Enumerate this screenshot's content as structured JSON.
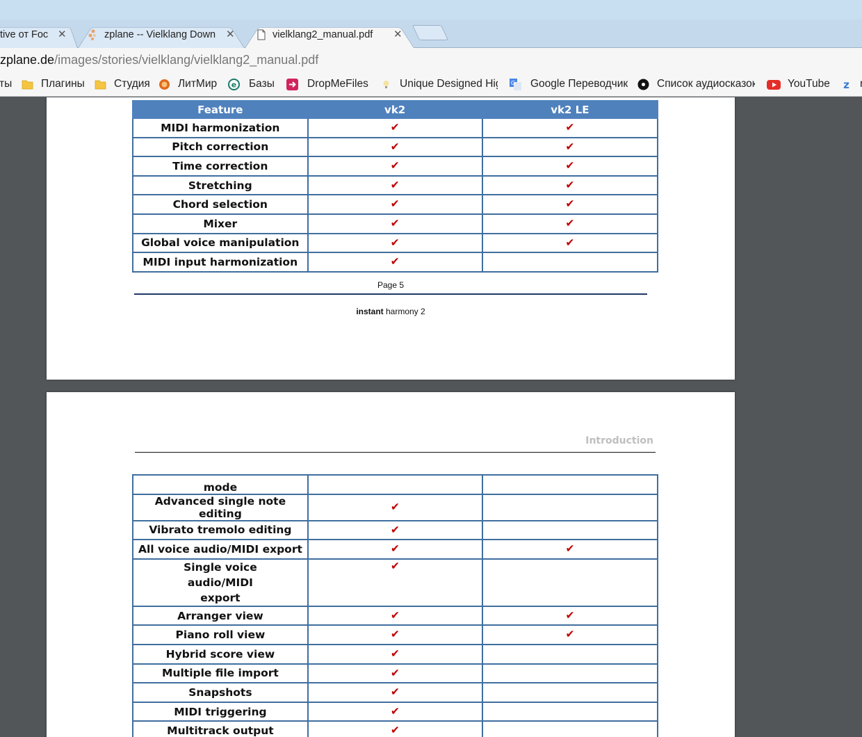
{
  "browser": {
    "tabs": [
      {
        "title": "tive от Foc",
        "close": "✕",
        "icon": "generic-icon"
      },
      {
        "title": "zplane -- Vielklang Down",
        "close": "✕",
        "icon": "zplane-favicon-icon"
      },
      {
        "title": "vielklang2_manual.pdf",
        "close": "✕",
        "icon": "document-icon"
      }
    ],
    "url": {
      "host": "zplane.de",
      "path": "/images/stories/vielklang/vielklang2_manual.pdf"
    },
    "bookmarks": [
      {
        "label": "ты",
        "icon": ""
      },
      {
        "label": "Плагины",
        "icon": "folder-icon"
      },
      {
        "label": "Студия",
        "icon": "folder-icon"
      },
      {
        "label": "ЛитМир",
        "icon": "litmir-icon"
      },
      {
        "label": "Базы",
        "icon": "e-icon"
      },
      {
        "label": "DropMeFiles",
        "icon": "dropmefiles-icon"
      },
      {
        "label": "Unique Designed Hig",
        "icon": "bulb-icon"
      },
      {
        "label": "Google Переводчик",
        "icon": "google-translate-icon"
      },
      {
        "label": "Список аудиосказок",
        "icon": "vinyl-icon"
      },
      {
        "label": "YouTube",
        "icon": "youtube-icon"
      },
      {
        "label": "r",
        "icon": "z-icon"
      }
    ]
  },
  "colors": {
    "table_header": "#4f81bd",
    "table_border": "#3f6e9f",
    "check": "#c00000"
  },
  "pdf": {
    "page1": {
      "table": {
        "headers": [
          "Feature",
          "vk2",
          "vk2 LE"
        ],
        "rows": [
          {
            "feature": "MIDI harmonization",
            "vk2": "✔",
            "vk2le": "✔"
          },
          {
            "feature": "Pitch correction",
            "vk2": "✔",
            "vk2le": "✔"
          },
          {
            "feature": "Time correction",
            "vk2": "✔",
            "vk2le": "✔"
          },
          {
            "feature": "Stretching",
            "vk2": "✔",
            "vk2le": "✔"
          },
          {
            "feature": "Chord selection",
            "vk2": "✔",
            "vk2le": "✔"
          },
          {
            "feature": "Mixer",
            "vk2": "✔",
            "vk2le": "✔"
          },
          {
            "feature": "Global voice manipulation",
            "vk2": "✔",
            "vk2le": "✔"
          },
          {
            "feature": "MIDI input harmonization",
            "vk2": "✔",
            "vk2le": ""
          }
        ]
      },
      "page_number": "Page 5",
      "footer_bold": "instant",
      "footer_rest": " harmony 2"
    },
    "page2": {
      "header": "Introduction",
      "table": {
        "rows": [
          {
            "feature": "mode",
            "vk2": "",
            "vk2le": ""
          },
          {
            "feature": "Advanced single note editing",
            "vk2": "✔",
            "vk2le": ""
          },
          {
            "feature": "Vibrato tremolo editing",
            "vk2": "✔",
            "vk2le": ""
          },
          {
            "feature": "All voice audio/MIDI export",
            "vk2": "✔",
            "vk2le": "✔"
          },
          {
            "feature": "Single voice audio/MIDI export",
            "vk2": "✔",
            "vk2le": ""
          },
          {
            "feature": "Arranger view",
            "vk2": "✔",
            "vk2le": "✔"
          },
          {
            "feature": "Piano roll view",
            "vk2": "✔",
            "vk2le": "✔"
          },
          {
            "feature": "Hybrid score view",
            "vk2": "✔",
            "vk2le": ""
          },
          {
            "feature": "Multiple file import",
            "vk2": "✔",
            "vk2le": ""
          },
          {
            "feature": "Snapshots",
            "vk2": "✔",
            "vk2le": ""
          },
          {
            "feature": "MIDI triggering",
            "vk2": "✔",
            "vk2le": ""
          },
          {
            "feature": "Multitrack output",
            "vk2": "✔",
            "vk2le": ""
          }
        ]
      }
    }
  }
}
